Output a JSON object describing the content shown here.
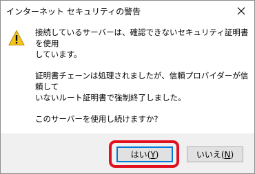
{
  "dialog": {
    "title": "インターネット セキュリティの警告",
    "close_icon": "close-icon",
    "warning_icon": "warning-triangle-icon",
    "colors": {
      "accent": "#0078d7",
      "highlight": "#e01020",
      "button_bar": "#f0f0f0",
      "warning": "#f5c518"
    }
  },
  "message": {
    "paragraph_1": "接続しているサーバーは、確認できないセキュリティ証明書を使用\nしています。",
    "paragraph_2": "証明書チェーンは処理されましたが、信頼プロバイダーが信頼して\nいないルート証明書で強制終了しました。",
    "paragraph_3": "このサーバーを使用し続けますか?"
  },
  "buttons": {
    "yes_prefix": "はい(",
    "yes_key": "Y",
    "yes_suffix": ")",
    "no_prefix": "いいえ(",
    "no_key": "N",
    "no_suffix": ")"
  }
}
